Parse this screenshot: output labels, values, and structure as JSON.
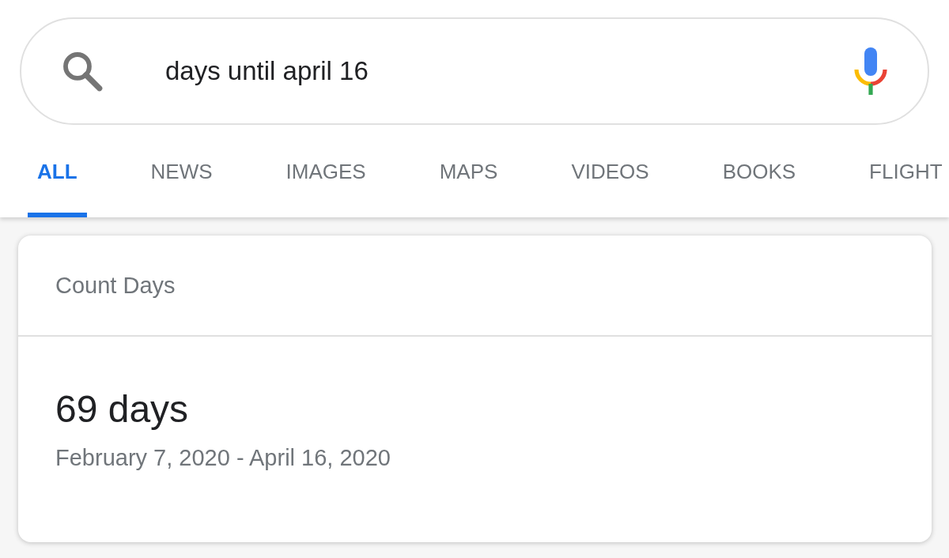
{
  "search": {
    "value": "days until april 16"
  },
  "tabs": [
    {
      "label": "ALL",
      "selected": true
    },
    {
      "label": "NEWS",
      "selected": false
    },
    {
      "label": "IMAGES",
      "selected": false
    },
    {
      "label": "MAPS",
      "selected": false
    },
    {
      "label": "VIDEOS",
      "selected": false
    },
    {
      "label": "BOOKS",
      "selected": false
    },
    {
      "label": "FLIGHT",
      "selected": false
    }
  ],
  "card": {
    "title": "Count Days",
    "result": "69 days",
    "range": "February 7, 2020 - April 16, 2020"
  }
}
